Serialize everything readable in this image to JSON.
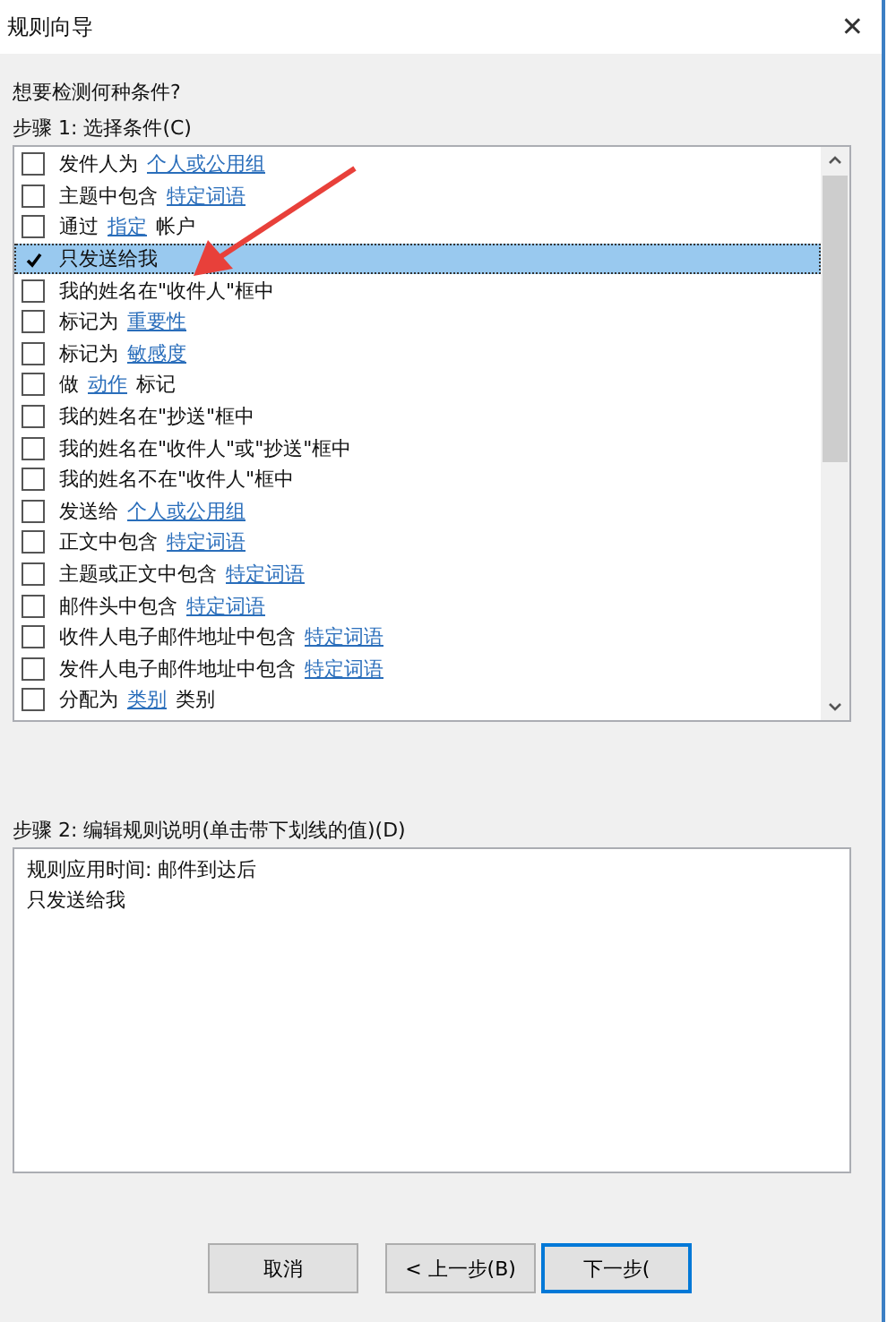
{
  "window": {
    "title": "规则向导",
    "close": "✕"
  },
  "question": "想要检测何种条件?",
  "step1_label": "步骤 1: 选择条件(C)",
  "conditions": [
    {
      "parts": [
        {
          "text": "发件人为",
          "link": false
        },
        {
          "text": "个人或公用组",
          "link": true
        }
      ],
      "checked": false,
      "selected": false
    },
    {
      "parts": [
        {
          "text": "主题中包含",
          "link": false
        },
        {
          "text": "特定词语",
          "link": true
        }
      ],
      "checked": false,
      "selected": false
    },
    {
      "parts": [
        {
          "text": "通过",
          "link": false
        },
        {
          "text": "指定",
          "link": true
        },
        {
          "text": "帐户",
          "link": false
        }
      ],
      "checked": false,
      "selected": false
    },
    {
      "parts": [
        {
          "text": "只发送给我",
          "link": false
        }
      ],
      "checked": true,
      "selected": true
    },
    {
      "parts": [
        {
          "text": "我的姓名在\"收件人\"框中",
          "link": false
        }
      ],
      "checked": false,
      "selected": false
    },
    {
      "parts": [
        {
          "text": "标记为",
          "link": false
        },
        {
          "text": "重要性",
          "link": true
        }
      ],
      "checked": false,
      "selected": false
    },
    {
      "parts": [
        {
          "text": "标记为",
          "link": false
        },
        {
          "text": "敏感度",
          "link": true
        }
      ],
      "checked": false,
      "selected": false
    },
    {
      "parts": [
        {
          "text": "做",
          "link": false
        },
        {
          "text": "动作",
          "link": true
        },
        {
          "text": "标记",
          "link": false
        }
      ],
      "checked": false,
      "selected": false
    },
    {
      "parts": [
        {
          "text": "我的姓名在\"抄送\"框中",
          "link": false
        }
      ],
      "checked": false,
      "selected": false
    },
    {
      "parts": [
        {
          "text": "我的姓名在\"收件人\"或\"抄送\"框中",
          "link": false
        }
      ],
      "checked": false,
      "selected": false
    },
    {
      "parts": [
        {
          "text": "我的姓名不在\"收件人\"框中",
          "link": false
        }
      ],
      "checked": false,
      "selected": false
    },
    {
      "parts": [
        {
          "text": "发送给",
          "link": false
        },
        {
          "text": "个人或公用组",
          "link": true
        }
      ],
      "checked": false,
      "selected": false
    },
    {
      "parts": [
        {
          "text": "正文中包含",
          "link": false
        },
        {
          "text": "特定词语",
          "link": true
        }
      ],
      "checked": false,
      "selected": false
    },
    {
      "parts": [
        {
          "text": "主题或正文中包含",
          "link": false
        },
        {
          "text": "特定词语",
          "link": true
        }
      ],
      "checked": false,
      "selected": false
    },
    {
      "parts": [
        {
          "text": "邮件头中包含",
          "link": false
        },
        {
          "text": "特定词语",
          "link": true
        }
      ],
      "checked": false,
      "selected": false
    },
    {
      "parts": [
        {
          "text": "收件人电子邮件地址中包含",
          "link": false
        },
        {
          "text": "特定词语",
          "link": true
        }
      ],
      "checked": false,
      "selected": false
    },
    {
      "parts": [
        {
          "text": "发件人电子邮件地址中包含",
          "link": false
        },
        {
          "text": "特定词语",
          "link": true
        }
      ],
      "checked": false,
      "selected": false
    },
    {
      "parts": [
        {
          "text": "分配为",
          "link": false
        },
        {
          "text": "类别",
          "link": true
        },
        {
          "text": "类别",
          "link": false
        }
      ],
      "checked": false,
      "selected": false
    }
  ],
  "step2_label": "步骤 2: 编辑规则说明(单击带下划线的值)(D)",
  "description": [
    "规则应用时间: 邮件到达后",
    "只发送给我"
  ],
  "buttons": [
    {
      "label": "取消",
      "focused": false
    },
    {
      "label": "< 上一步(B)",
      "focused": false
    },
    {
      "label": "下一步(",
      "focused": true
    }
  ]
}
